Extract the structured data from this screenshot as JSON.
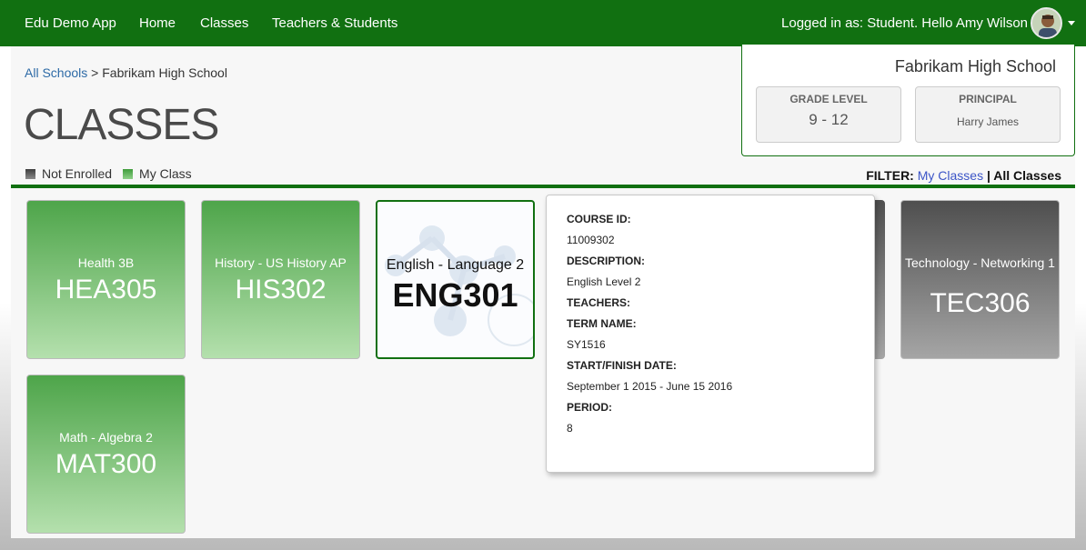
{
  "nav": {
    "brand": "Edu Demo App",
    "home": "Home",
    "classes": "Classes",
    "teachers_students": "Teachers & Students",
    "user_text": "Logged in as: Student. Hello Amy Wilson"
  },
  "breadcrumb": {
    "root": "All Schools",
    "separator": " > ",
    "current": "Fabrikam High School"
  },
  "page_title": "CLASSES",
  "legend": {
    "not_enrolled": "Not Enrolled",
    "my_class": "My Class"
  },
  "school": {
    "name": "Fabrikam High School",
    "grade_level_label": "GRADE LEVEL",
    "grade_level_value": "9 - 12",
    "principal_label": "PRINCIPAL",
    "principal_value": "Harry James"
  },
  "filter": {
    "label": "FILTER:",
    "my_classes": "My Classes",
    "separator": " | ",
    "all_classes": "All Classes"
  },
  "classes": [
    {
      "name": "Health 3B",
      "code": "HEA305"
    },
    {
      "name": "History - US History AP",
      "code": "HIS302"
    },
    {
      "name": "English - Language 2",
      "code": "ENG301"
    },
    {
      "name": "Technology - Networking 1",
      "code": "TEC306"
    },
    {
      "name": "Math - Algebra 2",
      "code": "MAT300"
    }
  ],
  "popover": {
    "course_id_label": "COURSE ID:",
    "course_id": "11009302",
    "description_label": "DESCRIPTION:",
    "description": "English Level 2",
    "teachers_label": "TEACHERS:",
    "term_name_label": "TERM NAME:",
    "term_name": "SY1516",
    "dates_label": "START/FINISH DATE:",
    "dates": "September 1 2015 - June 15 2016",
    "period_label": "PERIOD:",
    "period": "8"
  },
  "colors": {
    "nav_green": "#117011",
    "my_class_green": "#4ea54a",
    "not_enrolled_gray": "#4f4f4f",
    "link_blue": "#2d6aa6"
  }
}
